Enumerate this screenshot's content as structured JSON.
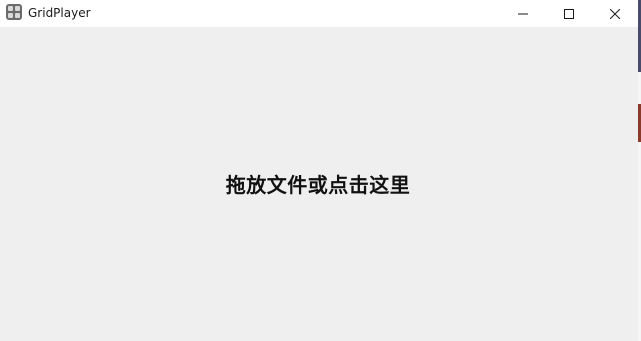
{
  "window": {
    "title": "GridPlayer",
    "app_icon": "grid-player-icon",
    "controls": {
      "minimize_icon": "minimize-icon",
      "maximize_icon": "maximize-icon",
      "close_icon": "close-icon"
    }
  },
  "main": {
    "drop_prompt": "拖放文件或点击这里"
  },
  "colors": {
    "titlebar_bg": "#ffffff",
    "content_bg": "#efefef",
    "text": "#111111"
  }
}
